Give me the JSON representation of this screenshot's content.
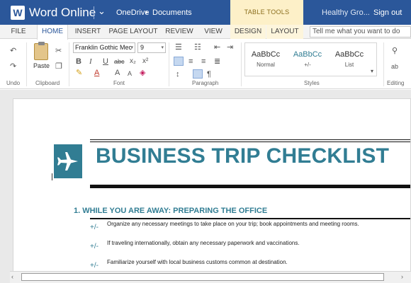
{
  "titlebar": {
    "app_name": "Word Online",
    "breadcrumb": [
      "OneDrive",
      "Documents"
    ],
    "contextual_group": "TABLE TOOLS",
    "user": "Healthy Gro...",
    "signout": "Sign out",
    "brand_color": "#2b579a"
  },
  "tabs": [
    {
      "label": "FILE"
    },
    {
      "label": "HOME",
      "active": true
    },
    {
      "label": "INSERT"
    },
    {
      "label": "PAGE LAYOUT"
    },
    {
      "label": "REVIEW"
    },
    {
      "label": "VIEW"
    },
    {
      "label": "DESIGN",
      "contextual": true
    },
    {
      "label": "LAYOUT",
      "contextual": true
    }
  ],
  "tell_me": {
    "placeholder": "Tell me what you want to do"
  },
  "ribbon": {
    "groups": {
      "undo": "Undo",
      "clipboard": "Clipboard",
      "font": "Font",
      "paragraph": "Paragraph",
      "styles": "Styles",
      "editing": "Editing"
    },
    "paste_label": "Paste",
    "font_name": "Franklin Gothic Mec",
    "font_size": "9",
    "font_buttons": [
      "B",
      "I",
      "U",
      "abc",
      "x₂",
      "x²"
    ],
    "styles": [
      {
        "sample": "AaBbCc",
        "name": "Normal"
      },
      {
        "sample": "AaBbCc",
        "name": "+/-",
        "color": "#317d93"
      },
      {
        "sample": "AaBbCc",
        "name": "List"
      }
    ]
  },
  "document": {
    "title": "BUSINESS TRIP CHECKLIST",
    "accent_color": "#317d93",
    "section": "1.  WHILE YOU ARE AWAY: PREPARING THE OFFICE",
    "items": [
      {
        "mark": "+/-",
        "text": "Organize any necessary meetings to take place on your trip; book appointments and meeting rooms."
      },
      {
        "mark": "+/-",
        "text": "If traveling internationally, obtain any necessary paperwork and vaccinations."
      },
      {
        "mark": "+/-",
        "text": "Familiarize yourself with local business customs common at destination."
      }
    ]
  },
  "scroll": {
    "left_arrow": "‹",
    "right_arrow": "›"
  }
}
